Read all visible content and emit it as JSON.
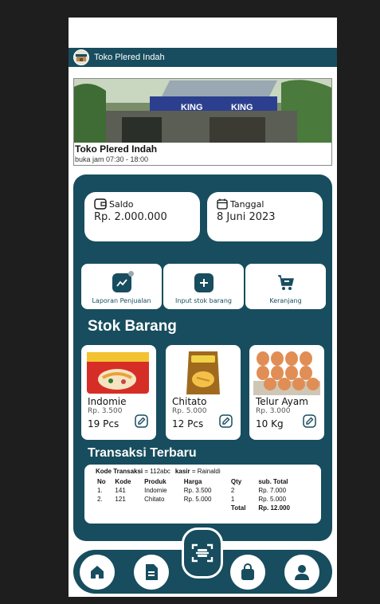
{
  "header": {
    "title": "Toko Plered Indah"
  },
  "banner": {
    "store_name": "Toko Plered Indah",
    "hours": "buka jam 07:30 - 18:00",
    "signs": [
      "KING",
      "KING"
    ]
  },
  "balance": {
    "label": "Saldo",
    "value": "Rp. 2.000.000"
  },
  "date": {
    "label": "Tanggal",
    "value": "8 Juni 2023"
  },
  "actions": [
    {
      "label": "Laporan Penjualan",
      "icon": "chart-icon"
    },
    {
      "label": "Input stok barang",
      "icon": "plus-icon"
    },
    {
      "label": "Keranjang",
      "icon": "cart-icon"
    }
  ],
  "stock": {
    "title": "Stok Barang",
    "items": [
      {
        "name": "Indomie",
        "price": "Rp. 3.500",
        "qty": "19",
        "unit": "Pcs"
      },
      {
        "name": "Chitato",
        "price": "Rp. 5.000",
        "qty": "12",
        "unit": "Pcs"
      },
      {
        "name": "Telur Ayam",
        "price": "Rp. 3.000",
        "qty": "10",
        "unit": "Kg"
      }
    ]
  },
  "transactions": {
    "title": "Transaksi Terbaru",
    "code_label": "Kode Transaksi",
    "code_value": "= 112abc",
    "cashier_label": "kasir",
    "cashier_value": "= Rainaldi",
    "columns": [
      "No",
      "Kode",
      "Produk",
      "Harga",
      "Qty",
      "sub. Total"
    ],
    "rows": [
      [
        "1.",
        "141",
        "Indomie",
        "Rp. 3.500",
        "2",
        "Rp. 7.000"
      ],
      [
        "2.",
        "121",
        "Chitato",
        "Rp. 5.000",
        "1",
        "Rp. 5.000"
      ]
    ],
    "total_label": "Total",
    "total_value": "Rp. 12.000"
  },
  "nav": [
    "home-icon",
    "document-icon",
    "scan-icon",
    "bag-icon",
    "profile-icon"
  ],
  "colors": {
    "primary": "#174d5e",
    "background": "#ffffff"
  }
}
